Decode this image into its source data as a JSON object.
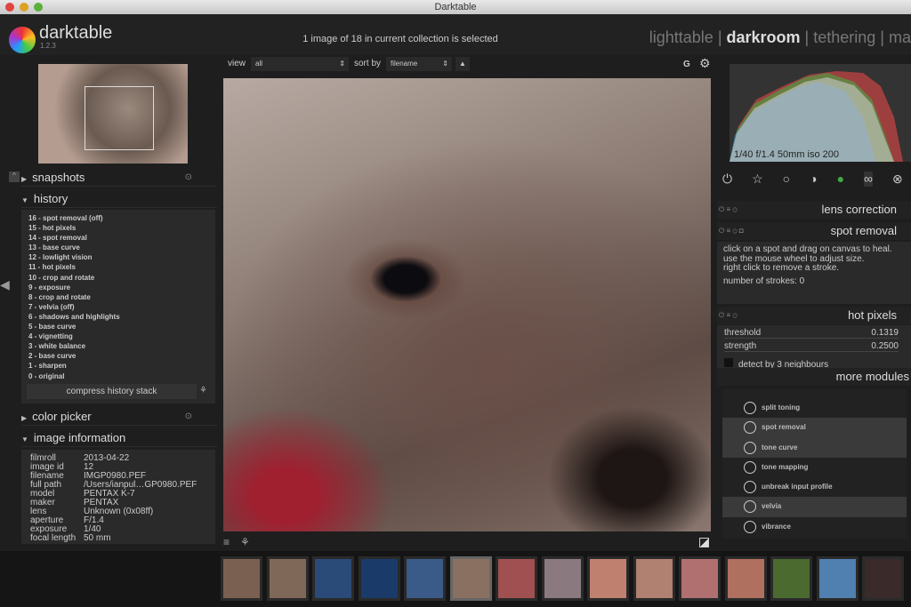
{
  "window": {
    "title": "Darktable"
  },
  "app": {
    "name": "darktable",
    "version": "1.2.3"
  },
  "header": {
    "selection_status": "1 image of 18 in current collection is selected",
    "views": [
      "lighttable",
      "darkroom",
      "tethering",
      "ma"
    ],
    "active_view": "darkroom"
  },
  "toolbar": {
    "view_label": "view",
    "view_value": "all",
    "sort_label": "sort by",
    "sort_value": "filename",
    "group_label": "G"
  },
  "left": {
    "snapshots": "snapshots",
    "history_title": "history",
    "history": [
      "16 - spot removal   (off)",
      "15 - hot pixels",
      "14 - spot removal",
      "13 - base curve",
      "12 - lowlight vision",
      "11 - hot pixels",
      "10 - crop and rotate",
      "9 - exposure",
      "8 - crop and rotate",
      "7 - velvia   (off)",
      "6 - shadows and highlights",
      "5 - base curve",
      "4 - vignetting",
      "3 - white balance",
      "2 - base curve",
      "1 - sharpen",
      "0 - original"
    ],
    "compress": "compress history stack",
    "color_picker": "color picker",
    "image_information": "image information",
    "info": [
      [
        "filmroll",
        "2013-04-22"
      ],
      [
        "image id",
        "12"
      ],
      [
        "filename",
        "IMGP0980.PEF"
      ],
      [
        "full path",
        "/Users/ianpul…GP0980.PEF"
      ],
      [
        "model",
        "PENTAX K-7"
      ],
      [
        "maker",
        "PENTAX"
      ],
      [
        "lens",
        "Unknown (0x08ff)"
      ],
      [
        "aperture",
        "F/1.4"
      ],
      [
        "exposure",
        "1/40"
      ],
      [
        "focal length",
        "50 mm"
      ]
    ]
  },
  "right": {
    "histogram_caption": "1/40 f/1.4 50mm iso 200",
    "lens_correction": "lens correction",
    "spot_removal": "spot removal",
    "spot_help": [
      "click on a spot and drag on canvas to heal.",
      "use the mouse wheel to adjust size.",
      "right click to remove a stroke."
    ],
    "strokes": "number of strokes:  0",
    "hot_pixels": "hot pixels",
    "sliders": [
      {
        "label": "threshold",
        "value": "0.1319"
      },
      {
        "label": "strength",
        "value": "0.2500"
      }
    ],
    "detect": "detect by 3 neighbours",
    "more_modules": "more modules",
    "modules": [
      {
        "name": "split toning",
        "active": false
      },
      {
        "name": "spot removal",
        "active": true
      },
      {
        "name": "tone curve",
        "active": true
      },
      {
        "name": "tone mapping",
        "active": false
      },
      {
        "name": "unbreak input profile",
        "active": false
      },
      {
        "name": "velvia",
        "active": true
      },
      {
        "name": "vibrance",
        "active": false
      }
    ]
  },
  "filmstrip": {
    "thumb_colors": [
      "#7a6050",
      "#806858",
      "#2a4a78",
      "#1a3a6a",
      "#3a5a88",
      "#8a7060",
      "#a05050",
      "#8a7a80",
      "#c08070",
      "#b08070",
      "#b07070",
      "#b07060",
      "#4a6a30",
      "#5080b0",
      "#3a2a2a"
    ],
    "selected_index": 5
  }
}
